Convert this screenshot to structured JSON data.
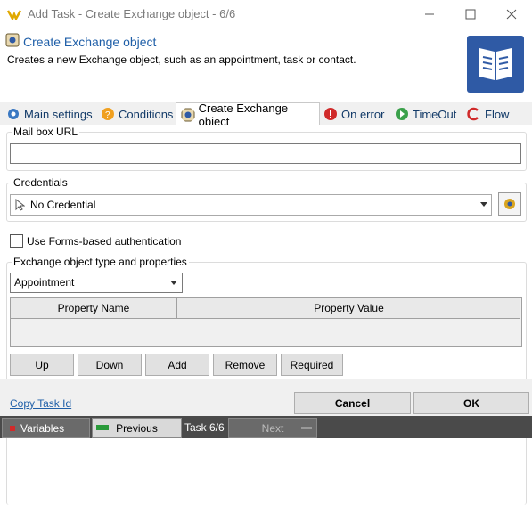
{
  "window": {
    "title": "Add Task - Create Exchange object - 6/6"
  },
  "header": {
    "title": "Create Exchange object",
    "description": "Creates a new Exchange object, such as an appointment, task or contact."
  },
  "tabs": [
    {
      "label": "Main settings"
    },
    {
      "label": "Conditions"
    },
    {
      "label": "Create Exchange object"
    },
    {
      "label": "On error"
    },
    {
      "label": "TimeOut"
    },
    {
      "label": "Flow"
    }
  ],
  "mailbox": {
    "label": "Mail box URL",
    "value": ""
  },
  "credentials": {
    "label": "Credentials",
    "value": "No Credential"
  },
  "forms_auth": {
    "label": "Use Forms-based authentication",
    "checked": false
  },
  "object_group": {
    "label": "Exchange object type and properties",
    "type_value": "Appointment",
    "columns": [
      "Property Name",
      "Property Value"
    ],
    "buttons": {
      "up": "Up",
      "down": "Down",
      "add": "Add",
      "remove": "Remove",
      "required": "Required"
    }
  },
  "footer": {
    "copy_link": "Copy Task Id",
    "cancel": "Cancel",
    "ok": "OK"
  },
  "statusbar": {
    "variables": "Variables",
    "previous": "Previous",
    "task": "Task 6/6",
    "next": "Next"
  },
  "colors": {
    "accent": "#1f5fa8",
    "icon_bg": "#2f5aa5",
    "statusbar": "#4a4a4a"
  }
}
